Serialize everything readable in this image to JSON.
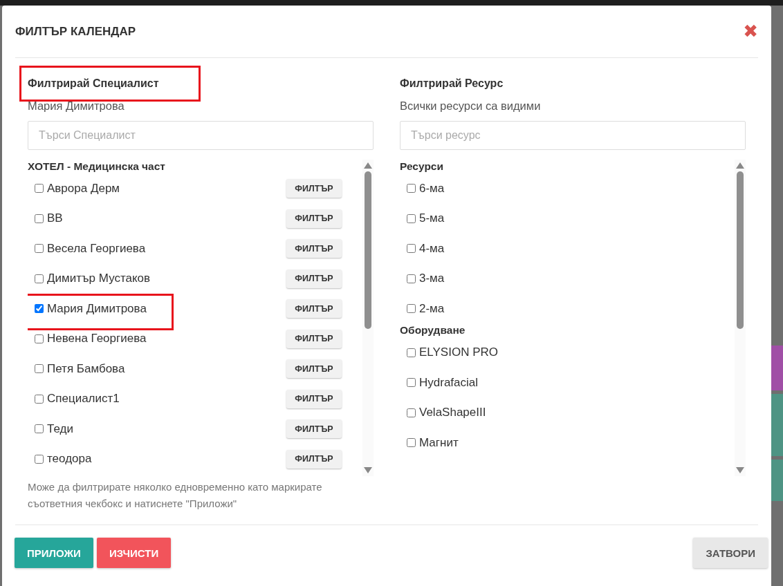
{
  "dialog": {
    "title": "ФИЛТЪР КАЛЕНДАР",
    "close_icon": "✖"
  },
  "specialists": {
    "heading": "Филтрирай Специалист",
    "highlighted": true,
    "summary": "Мария Димитрова",
    "search": {
      "placeholder": "Търси Специалист"
    },
    "groups": [
      {
        "title": "ХОТЕЛ - Медицинска част",
        "items": [
          {
            "label": "Аврора Дерм",
            "checked": false,
            "highlighted": false,
            "button": "ФИЛТЪР"
          },
          {
            "label": "ВВ",
            "checked": false,
            "highlighted": false,
            "button": "ФИЛТЪР"
          },
          {
            "label": "Весела Георгиева",
            "checked": false,
            "highlighted": false,
            "button": "ФИЛТЪР"
          },
          {
            "label": "Димитър Мустаков",
            "checked": false,
            "highlighted": false,
            "button": "ФИЛТЪР"
          },
          {
            "label": "Мария Димитрова",
            "checked": true,
            "highlighted": true,
            "button": "ФИЛТЪР"
          },
          {
            "label": "Невена Георгиева",
            "checked": false,
            "highlighted": false,
            "button": "ФИЛТЪР"
          },
          {
            "label": "Петя Бамбова",
            "checked": false,
            "highlighted": false,
            "button": "ФИЛТЪР"
          },
          {
            "label": "Специалист1",
            "checked": false,
            "highlighted": false,
            "button": "ФИЛТЪР"
          },
          {
            "label": "Теди",
            "checked": false,
            "highlighted": false,
            "button": "ФИЛТЪР"
          },
          {
            "label": "теодора",
            "checked": false,
            "highlighted": false,
            "button": "ФИЛТЪР"
          }
        ]
      }
    ],
    "help": "Може да филтрирате няколко едновременно като маркирате съответния чекбокс и натиснете \"Приложи\""
  },
  "resources": {
    "heading": "Филтрирай Ресурс",
    "highlighted": false,
    "summary": "Всички ресурси са видими",
    "search": {
      "placeholder": "Търси ресурс"
    },
    "groups": [
      {
        "title": "Ресурси",
        "items": [
          {
            "label": "6-ма",
            "checked": false
          },
          {
            "label": "5-ма",
            "checked": false
          },
          {
            "label": "4-ма",
            "checked": false
          },
          {
            "label": "3-ма",
            "checked": false
          },
          {
            "label": "2-ма",
            "checked": false
          }
        ]
      },
      {
        "title": "Оборудване",
        "items": [
          {
            "label": "ELYSION PRO",
            "checked": false
          },
          {
            "label": "Hydrafacial",
            "checked": false
          },
          {
            "label": "VelaShapeIII",
            "checked": false
          },
          {
            "label": "Магнит",
            "checked": false
          }
        ]
      }
    ]
  },
  "footer": {
    "buttons": [
      {
        "label": "ПРИЛОЖИ",
        "kind": "primary"
      },
      {
        "label": "ИЗЧИСТИ",
        "kind": "danger"
      },
      {
        "label": "ЗАТВОРИ",
        "kind": "default"
      }
    ]
  }
}
